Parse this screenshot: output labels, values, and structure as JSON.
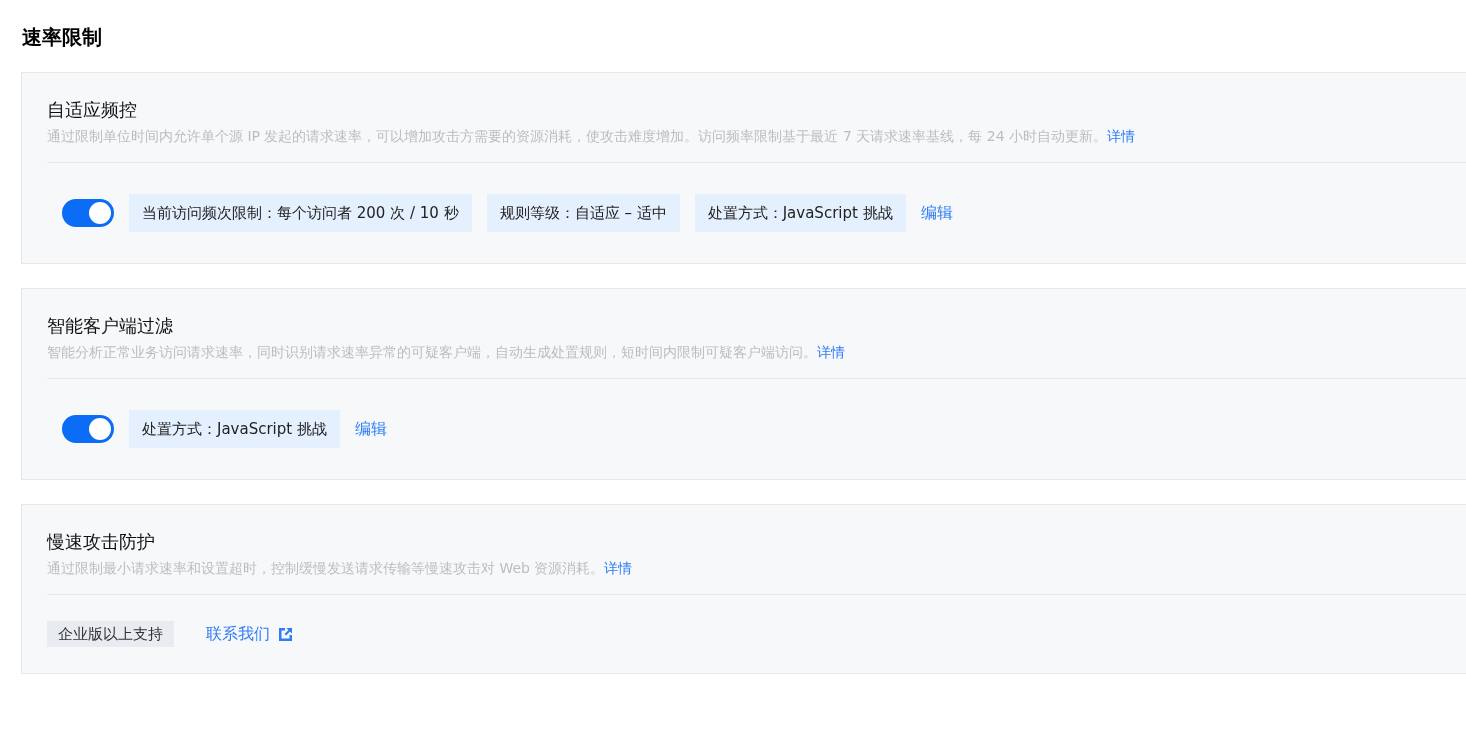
{
  "page_title": "速率限制",
  "sections": [
    {
      "kind": "toggle",
      "title": "自适应频控",
      "description": "通过限制单位时间内允许单个源 IP 发起的请求速率，可以增加攻击方需要的资源消耗，使攻击难度增加。访问频率限制基于最近 7 天请求速率基线，每 24 小时自动更新。",
      "details_link": "详情",
      "on": true,
      "tags": [
        "当前访问频次限制：每个访问者 200 次 / 10 秒",
        "规则等级：自适应 – 适中",
        "处置方式：JavaScript 挑战"
      ],
      "action_link": "编辑"
    },
    {
      "kind": "toggle",
      "title": "智能客户端过滤",
      "description": "智能分析正常业务访问请求速率，同时识别请求速率异常的可疑客户端，自动生成处置规则，短时间内限制可疑客户端访问。",
      "details_link": "详情",
      "on": true,
      "tags": [
        "处置方式：JavaScript 挑战"
      ],
      "action_link": "编辑"
    },
    {
      "kind": "upgrade",
      "title": "慢速攻击防护",
      "description": "通过限制最小请求速率和设置超时，控制缓慢发送请求传输等慢速攻击对 Web 资源消耗。",
      "details_link": "详情",
      "tags": [
        "企业版以上支持"
      ],
      "action_link": "联系我们"
    }
  ]
}
